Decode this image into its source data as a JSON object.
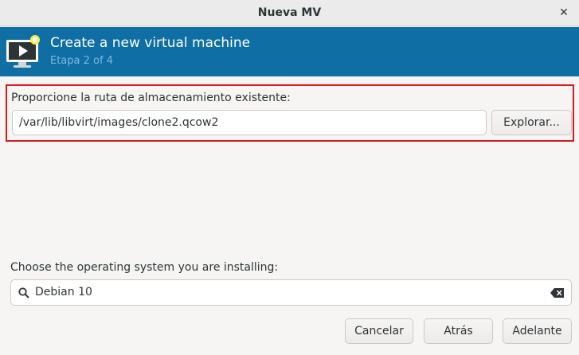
{
  "window": {
    "title": "Nueva MV"
  },
  "banner": {
    "heading": "Create a new virtual machine",
    "step": "Etapa 2 of 4"
  },
  "storage": {
    "label": "Proporcione la ruta de almacenamiento existente:",
    "path_value": "/var/lib/libvirt/images/clone2.qcow2",
    "browse_label": "Explorar..."
  },
  "os": {
    "label": "Choose the operating system you are installing:",
    "search_value": "Debian 10"
  },
  "footer": {
    "cancel_label": "Cancelar",
    "back_label": "Atrás",
    "forward_label": "Adelante"
  },
  "colors": {
    "banner_bg": "#0f6fa5",
    "highlight_border": "#d41a1a"
  },
  "icons": {
    "close": "close-icon",
    "banner": "vm-screen-play-icon",
    "search": "search-icon",
    "clear": "clear-text-icon"
  }
}
